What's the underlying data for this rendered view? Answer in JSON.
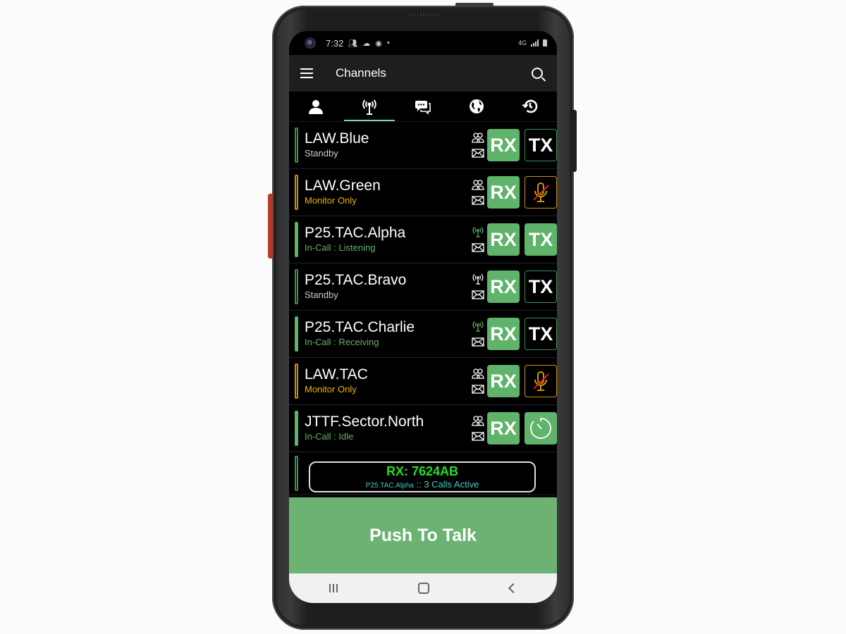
{
  "status_bar": {
    "time": "7:32",
    "left_icons": [
      "people-icon",
      "cloud-icon",
      "location-icon",
      "dot-icon"
    ],
    "network": "4G LTE",
    "right_icons": [
      "network-4g-icon",
      "signal-icon",
      "battery-icon"
    ]
  },
  "app_bar": {
    "title": "Channels",
    "menu_icon": "hamburger-menu-icon",
    "search_icon": "search-icon"
  },
  "tabs": [
    {
      "name": "contacts",
      "icon": "person-icon",
      "active": false
    },
    {
      "name": "channels",
      "icon": "radio-tower-icon",
      "active": true
    },
    {
      "name": "messages",
      "icon": "chat-bubbles-icon",
      "active": false
    },
    {
      "name": "global",
      "icon": "globe-icon",
      "active": false
    },
    {
      "name": "history",
      "icon": "history-icon",
      "active": false
    }
  ],
  "channels": [
    {
      "name": "LAW.Blue",
      "status": "Standby",
      "type_icon": "group-icon",
      "rx": "RX",
      "tx": "TX",
      "tx_state": "off"
    },
    {
      "name": "LAW.Green",
      "status": "Monitor Only",
      "type_icon": "group-icon",
      "rx": "RX",
      "tx": "",
      "tx_state": "muted"
    },
    {
      "name": "P25.TAC.Alpha",
      "status": "In-Call : Listening",
      "type_icon": "radio-tower-icon",
      "rx": "RX",
      "tx": "TX",
      "tx_state": "on"
    },
    {
      "name": "P25.TAC.Bravo",
      "status": "Standby",
      "type_icon": "radio-tower-icon",
      "rx": "RX",
      "tx": "TX",
      "tx_state": "off"
    },
    {
      "name": "P25.TAC.Charlie",
      "status": "In-Call : Receiving",
      "type_icon": "radio-tower-icon",
      "rx": "RX",
      "tx": "TX",
      "tx_state": "off"
    },
    {
      "name": "LAW.TAC",
      "status": "Monitor Only",
      "type_icon": "group-icon",
      "rx": "RX",
      "tx": "",
      "tx_state": "muted"
    },
    {
      "name": "JTTF.Sector.North",
      "status": "In-Call : Idle",
      "type_icon": "group-icon",
      "rx": "RX",
      "tx": "",
      "tx_state": "timer"
    }
  ],
  "toast": {
    "title": "RX: 7624AB",
    "channel": "P25.TAC.Alpha",
    "separator": " :: ",
    "calls": "3 Calls Active"
  },
  "ptt": {
    "label": "Push To Talk"
  },
  "colors": {
    "accent_green": "#5fb36a",
    "ptt_green": "#6cb272",
    "amber": "#f0b000",
    "tab_indicator": "#7fd0c0",
    "toast_green": "#22dd22",
    "toast_cyan": "#4cc8c0"
  }
}
